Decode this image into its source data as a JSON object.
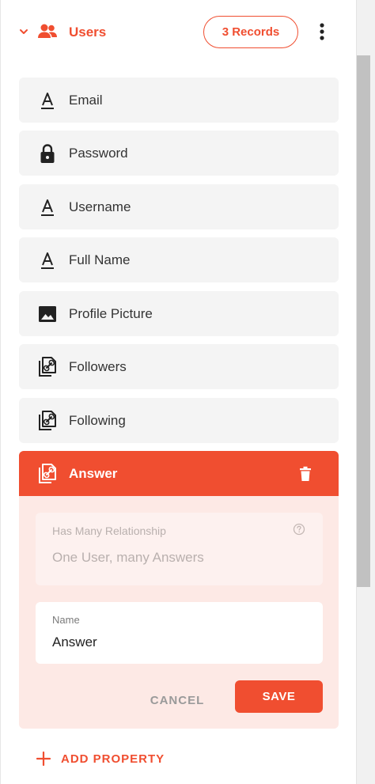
{
  "header": {
    "title": "Users",
    "records_label": "3 Records",
    "collapse_icon": "chevron-down-icon",
    "users_icon": "people-icon",
    "more_icon": "more-vertical-icon"
  },
  "properties": [
    {
      "label": "Email",
      "icon": "text-field-icon"
    },
    {
      "label": "Password",
      "icon": "lock-icon"
    },
    {
      "label": "Username",
      "icon": "text-field-icon"
    },
    {
      "label": "Full Name",
      "icon": "text-field-icon"
    },
    {
      "label": "Profile Picture",
      "icon": "image-icon"
    },
    {
      "label": "Followers",
      "icon": "relation-icon"
    },
    {
      "label": "Following",
      "icon": "relation-icon"
    }
  ],
  "editing": {
    "title": "Answer",
    "icon": "relation-icon",
    "delete_icon": "trash-icon",
    "relationship": {
      "label": "Has Many Relationship",
      "value": "One User, many Answers",
      "help_icon": "help-circle-icon"
    },
    "name_field": {
      "label": "Name",
      "value": "Answer"
    },
    "cancel_label": "CANCEL",
    "save_label": "SAVE"
  },
  "add_property_label": "ADD PROPERTY",
  "colors": {
    "accent": "#f04e30",
    "card_bg": "#f4f4f4",
    "editing_bg": "#fde9e5"
  }
}
